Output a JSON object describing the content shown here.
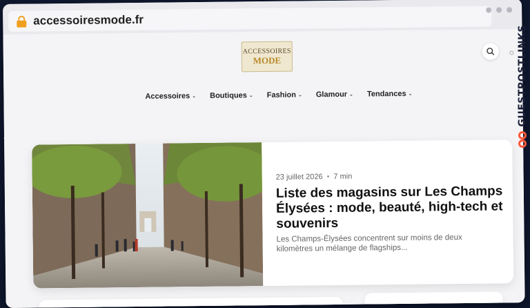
{
  "browser": {
    "url": "accessoiresmode.fr"
  },
  "site": {
    "logo_line1": "ACCESSOIRES",
    "logo_line2": "MODE",
    "nav": [
      {
        "label": "Accessoires"
      },
      {
        "label": "Boutiques"
      },
      {
        "label": "Fashion"
      },
      {
        "label": "Glamour"
      },
      {
        "label": "Tendances"
      }
    ]
  },
  "featured": {
    "date": "23 juillet 2026",
    "read_time": "7 min",
    "title": "Liste des magasins sur Les Champs Élysées : mode, beauté, high-tech et souvenirs",
    "excerpt": "Les Champs-Élysées concentrent sur moins de deux kilomètres un mélange de flagships..."
  },
  "badge": {
    "text": "GUESTPOSTLINKS"
  },
  "colors": {
    "lock": "#f0a020",
    "badge_logo": "#ff5a3c"
  }
}
